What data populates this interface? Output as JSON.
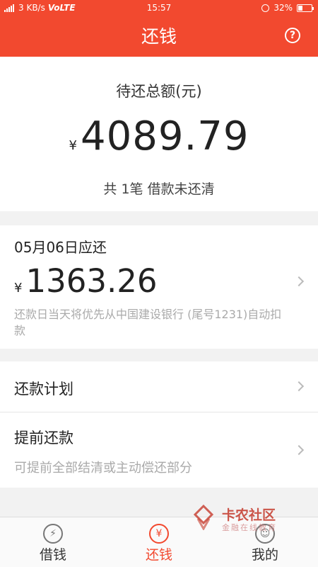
{
  "status_bar": {
    "network": "4G",
    "speed": "3 KB/s",
    "carrier_label": "VoLTE",
    "time": "15:57",
    "battery": "32%"
  },
  "header": {
    "title": "还钱",
    "help_glyph": "?"
  },
  "summary": {
    "label": "待还总额(元)",
    "currency": "¥",
    "amount": "4089.79",
    "sub": "共 1笔 借款未还清"
  },
  "due": {
    "date_label": "05月06日应还",
    "currency": "¥",
    "amount": "1363.26",
    "note": "还款日当天将优先从中国建设银行 (尾号1231)自动扣款"
  },
  "menu": {
    "plan_label": "还款计划",
    "prepay_label": "提前还款",
    "prepay_sub": "可提前全部结清或主动偿还部分"
  },
  "tabs": [
    {
      "label": "借钱",
      "icon": "lightning-icon",
      "glyph": "⚡"
    },
    {
      "label": "还钱",
      "icon": "yen-icon",
      "glyph": "¥"
    },
    {
      "label": "我的",
      "icon": "smile-icon",
      "glyph": "☺"
    }
  ],
  "watermark": {
    "title": "卡农社区",
    "subtitle": "金融在线教育"
  },
  "colors": {
    "accent": "#f2492f",
    "background": "#f2f2f2"
  }
}
